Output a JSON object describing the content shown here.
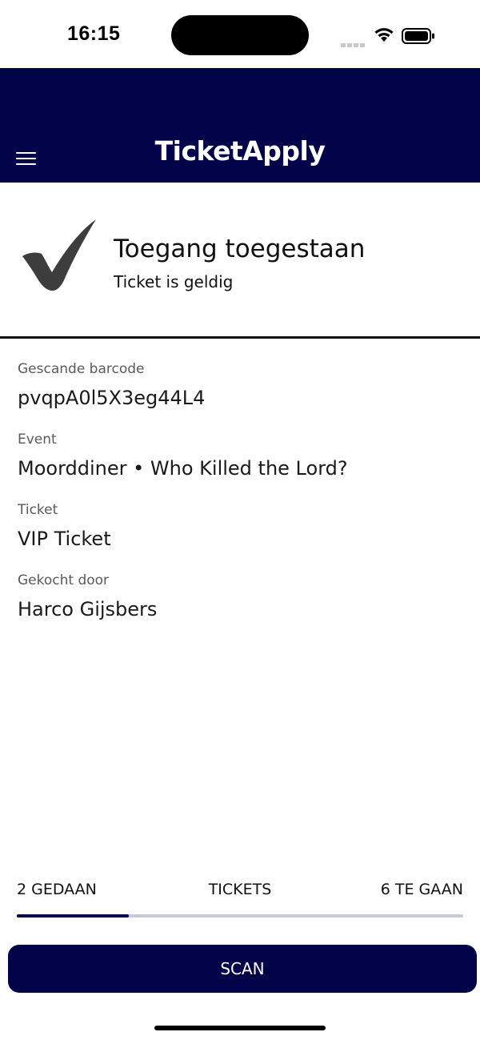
{
  "status_bar": {
    "time": "16:15",
    "icons": [
      "signal-icon",
      "wifi-icon",
      "battery-icon"
    ]
  },
  "header": {
    "app_name": "TicketApply",
    "menu_icon": "hamburger-menu-icon",
    "background_color": "#03034a"
  },
  "result": {
    "icon": "checkmark-icon",
    "title": "Toegang toegestaan",
    "subtitle": "Ticket is geldig"
  },
  "details": [
    {
      "label": "Gescande barcode",
      "value": "pvqpA0l5X3eg44L4"
    },
    {
      "label": "Event",
      "value": "Moorddiner • Who Killed the Lord?"
    },
    {
      "label": "Ticket",
      "value": "VIP Ticket"
    },
    {
      "label": "Gekocht door",
      "value": "Harco Gijsbers"
    }
  ],
  "progress": {
    "done_label": "2 GEDAAN",
    "middle_label": "TICKETS",
    "todo_label": "6 TE GAAN",
    "fraction_done": 0.25
  },
  "scan_button": {
    "label": "SCAN"
  },
  "colors": {
    "primary": "#03034a",
    "track": "#c7c9dc",
    "check": "#3d3d3d"
  }
}
